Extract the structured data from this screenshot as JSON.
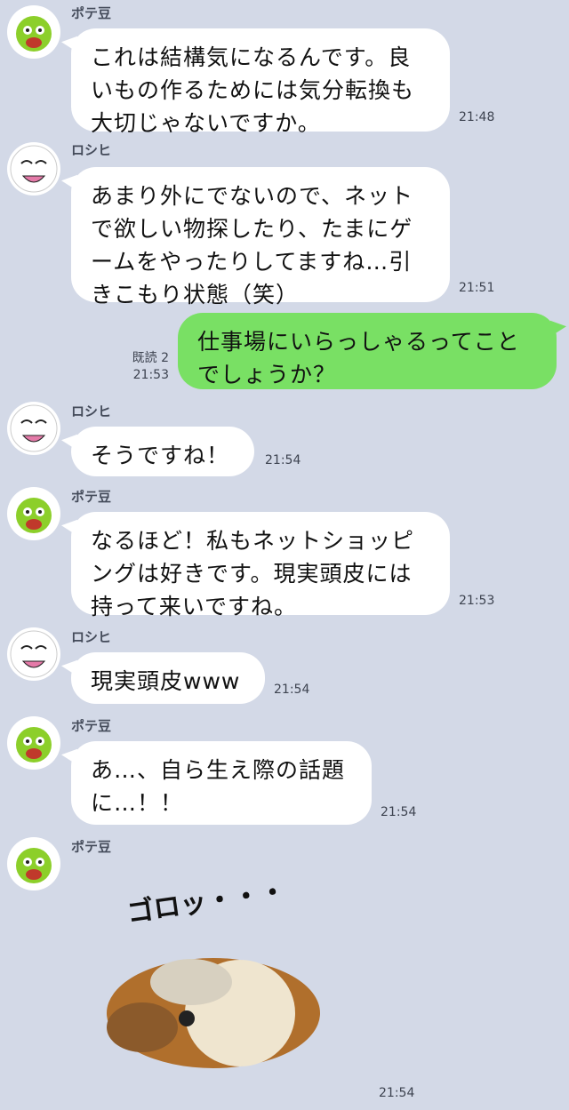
{
  "messages": [
    {
      "sender": "ポテ豆",
      "text": "これは結構気になるんです。良\nいもの作るためには気分転換も\n大切じゃないですか。",
      "time": "21:48"
    },
    {
      "sender": "ロシヒ",
      "text": "あまり外にでないので、ネット\nで欲しい物探したり、たまにゲ\nームをやったりしてますね…引\nきこもり状態（笑）",
      "time": "21:51"
    },
    {
      "sender": "me",
      "text": "仕事場にいらっしゃるってこと\nでしょうか？",
      "read": "既読 2",
      "time": "21:53"
    },
    {
      "sender": "ロシヒ",
      "text": "そうですね！",
      "time": "21:54"
    },
    {
      "sender": "ポテ豆",
      "text": "なるほど！私もネットショッピ\nングは好きです。現実頭皮には\n持って来いですね。",
      "time": "21:53"
    },
    {
      "sender": "ロシヒ",
      "text": "現実頭皮www",
      "time": "21:54"
    },
    {
      "sender": "ポテ豆",
      "text": "あ…、自ら生え際の話題\nに…！！",
      "time": "21:54"
    },
    {
      "sender": "ポテ豆",
      "sticker_text": "ゴロッ・・・",
      "time": "21:54"
    }
  ],
  "colors": {
    "background": "#d3d9e7",
    "incoming": "#ffffff",
    "outgoing": "#79e064"
  }
}
